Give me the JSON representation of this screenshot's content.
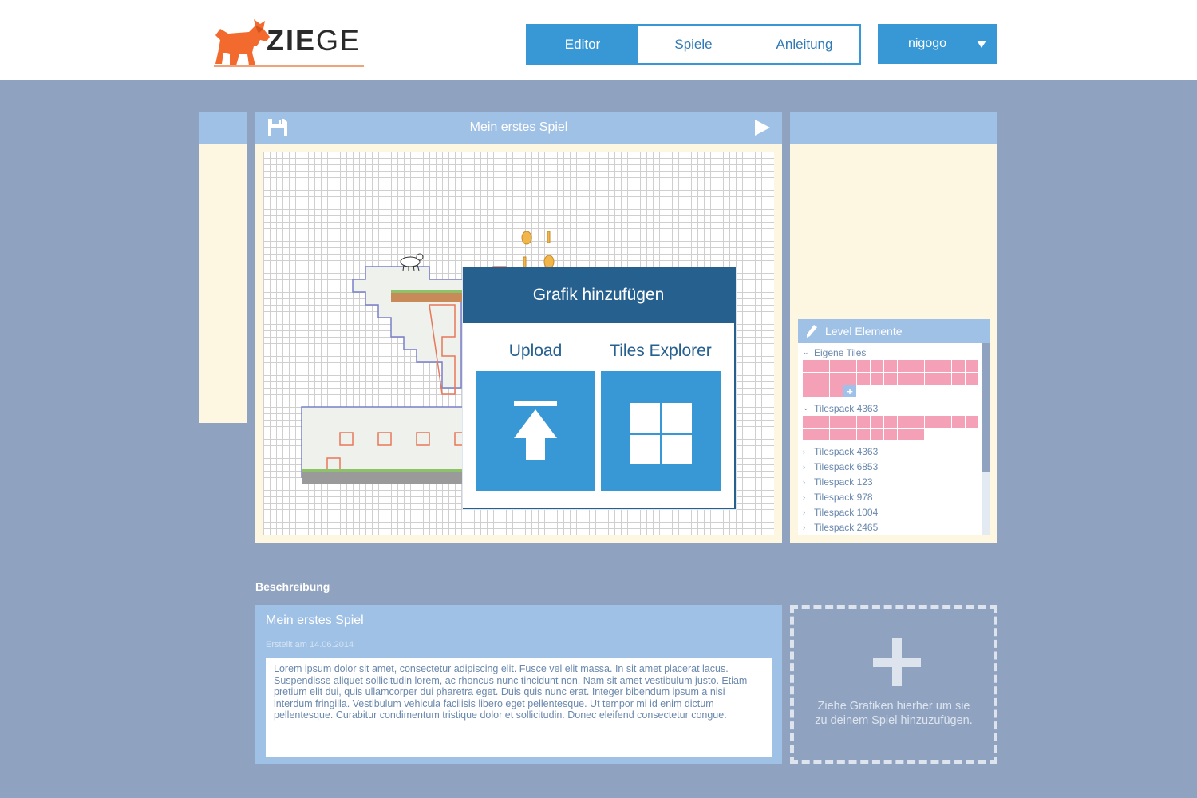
{
  "brand": {
    "logo_text_bold": "ZIE",
    "logo_text_light": "GE"
  },
  "nav": {
    "items": [
      {
        "label": "Editor",
        "active": true
      },
      {
        "label": "Spiele",
        "active": false
      },
      {
        "label": "Anleitung",
        "active": false
      }
    ]
  },
  "user": {
    "name": "nigogo"
  },
  "editor": {
    "title": "Mein erstes Spiel"
  },
  "modal": {
    "title": "Grafik hinzufügen",
    "upload_label": "Upload",
    "explorer_label": "Tiles Explorer"
  },
  "level_panel": {
    "title": "Level Elemente",
    "groups": [
      {
        "name": "Eigene Tiles",
        "expanded": true,
        "tile_count": 29,
        "has_add": true
      },
      {
        "name": "Tilespack 4363",
        "expanded": true,
        "tile_count": 22,
        "has_add": false
      },
      {
        "name": "Tilespack 4363",
        "expanded": false
      },
      {
        "name": "Tilespack 6853",
        "expanded": false
      },
      {
        "name": "Tilespack 123",
        "expanded": false
      },
      {
        "name": "Tilespack 978",
        "expanded": false
      },
      {
        "name": "Tilespack 1004",
        "expanded": false
      },
      {
        "name": "Tilespack 2465",
        "expanded": false
      }
    ]
  },
  "description": {
    "section_label": "Beschreibung",
    "title": "Mein erstes Spiel",
    "created": "Erstellt am 14.06.2014",
    "text": "Lorem ipsum dolor sit amet, consectetur adipiscing elit. Fusce vel elit massa. In sit amet placerat lacus. Suspendisse aliquet sollicitudin lorem, ac rhoncus nunc tincidunt non. Nam sit amet vestibulum justo. Etiam pretium elit dui, quis ullamcorper dui pharetra eget. Duis quis nunc erat. Integer bibendum ipsum a nisi interdum fringilla. Vestibulum vehicula facilisis libero eget pellentesque. Ut tempor mi id enim dictum pellentesque. Curabitur condimentum tristique dolor et sollicitudin. Donec eleifend consectetur congue."
  },
  "dropzone": {
    "text": "Ziehe Grafiken hierher um sie zu deinem Spiel hinzuzufügen."
  },
  "colors": {
    "accent": "#3898d6",
    "modal_head": "#26608f",
    "panel_bar": "#a0c1e6",
    "panel_bg": "#fdf7e1",
    "page_bg": "#8fa2bf",
    "tile_pink": "#f4a1b8"
  }
}
